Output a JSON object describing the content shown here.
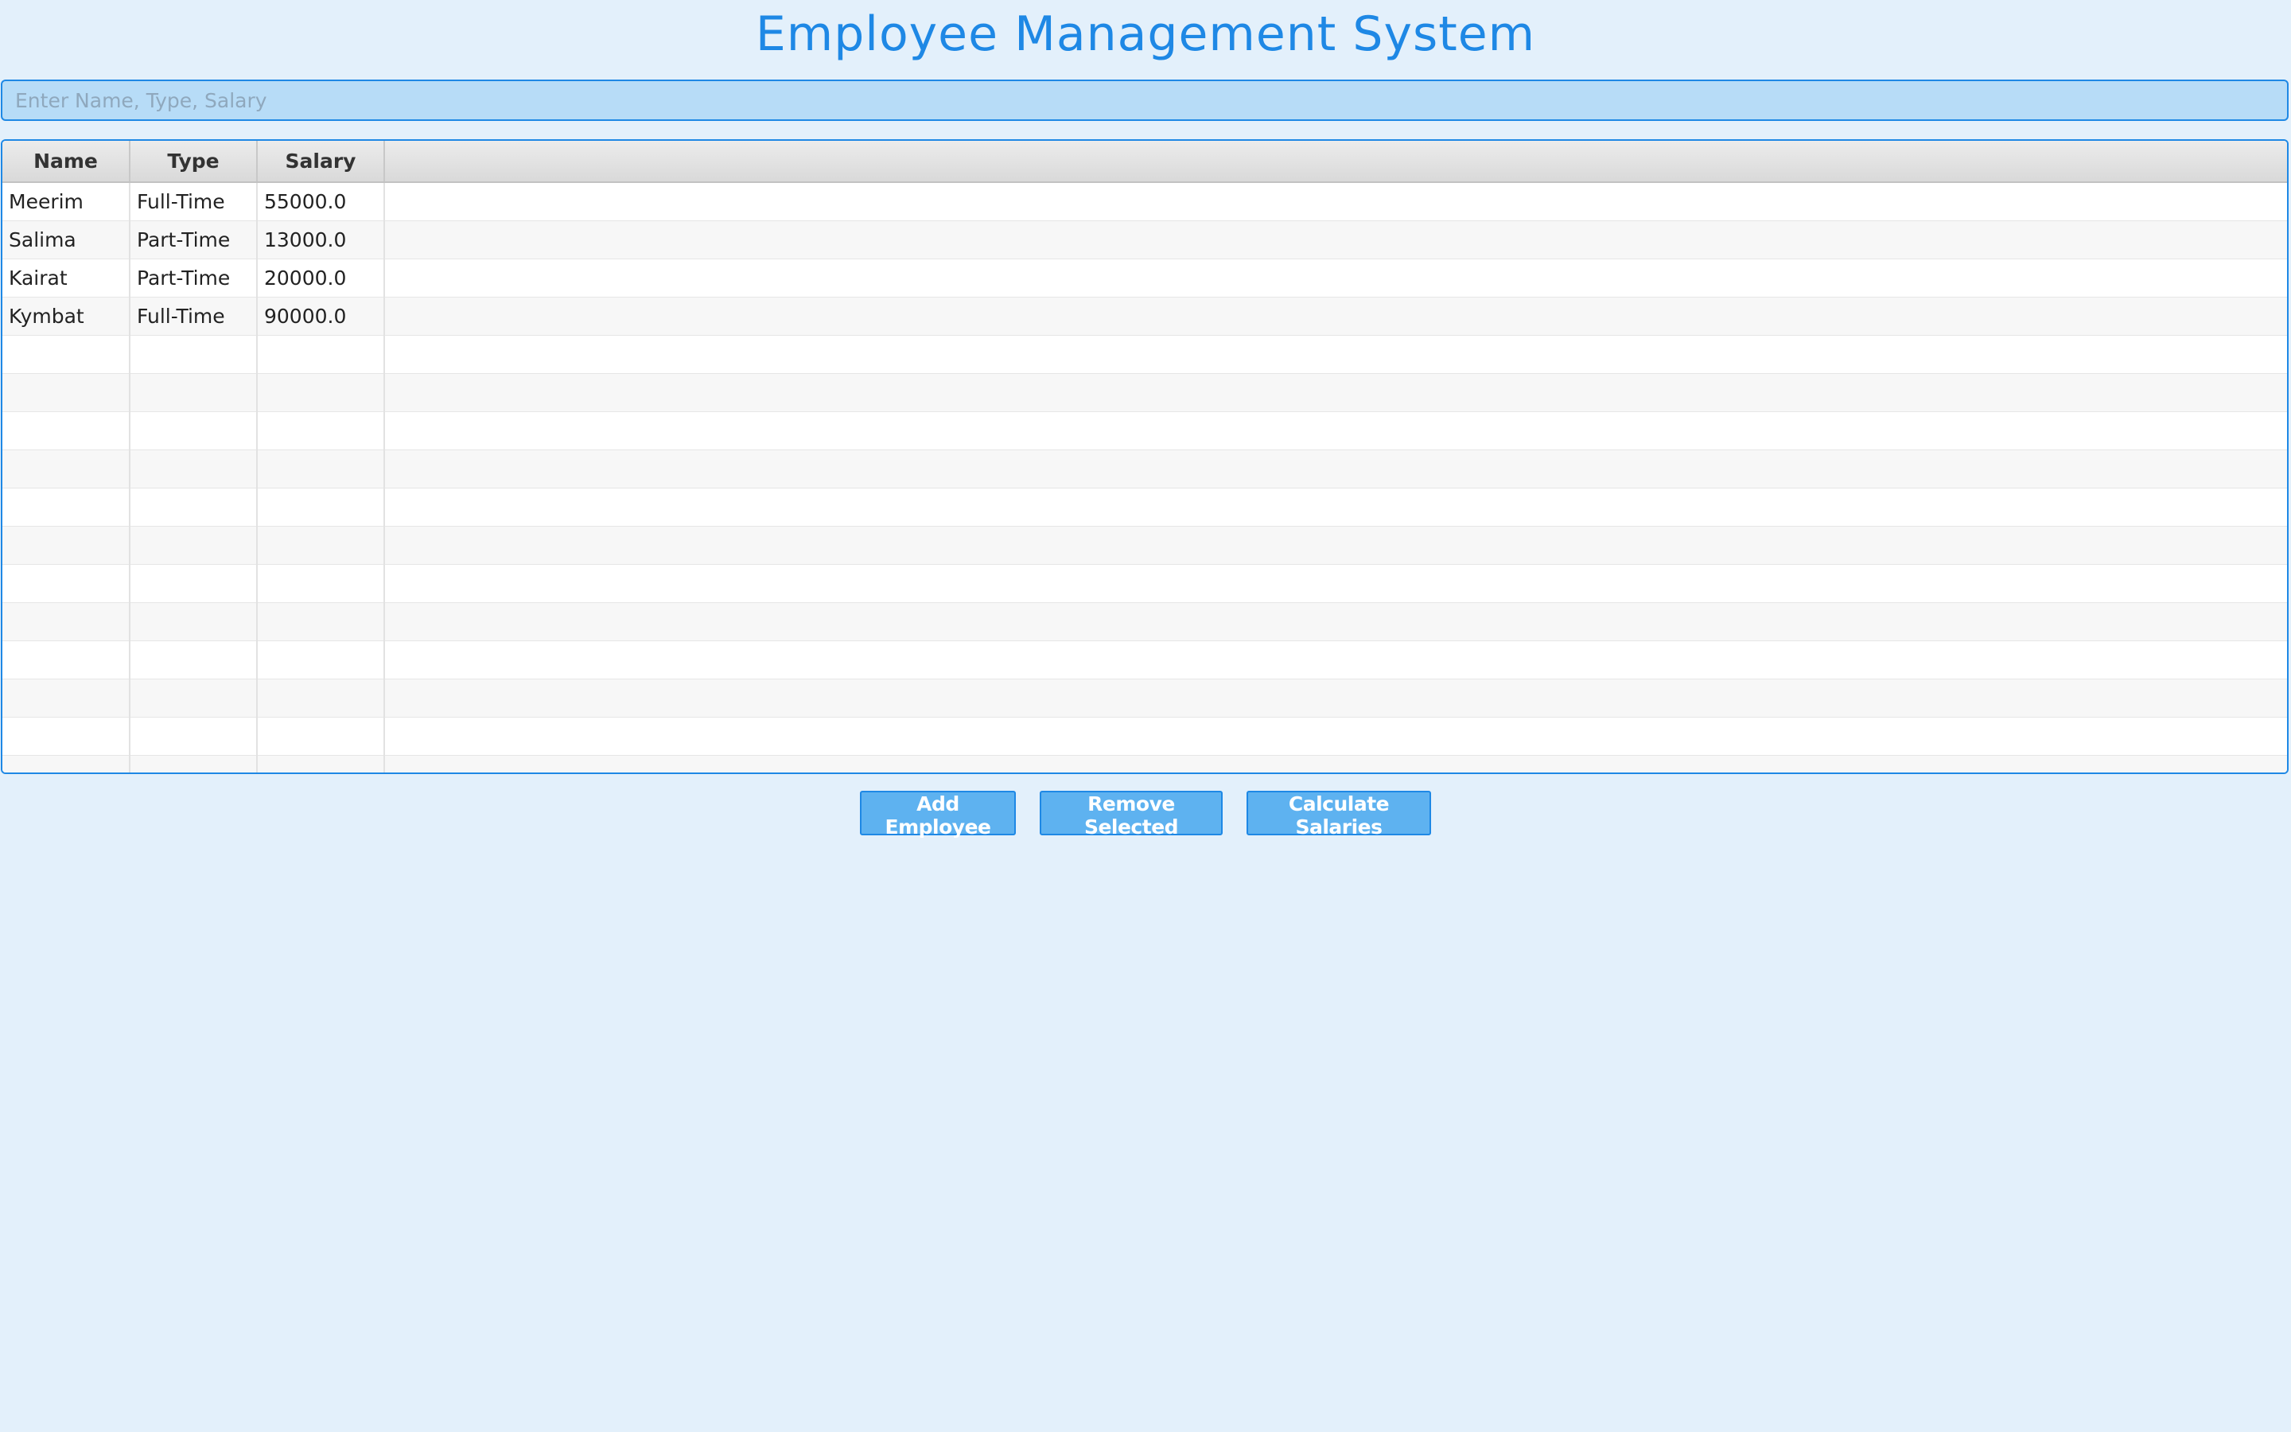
{
  "app": {
    "title": "Employee Management System"
  },
  "search": {
    "placeholder": "Enter Name, Type, Salary",
    "value": ""
  },
  "table": {
    "columns": [
      "Name",
      "Type",
      "Salary",
      ""
    ],
    "rows": [
      [
        "Meerim",
        "Full-Time",
        "55000.0",
        ""
      ],
      [
        "Salima",
        "Part-Time",
        "13000.0",
        ""
      ],
      [
        "Kairat",
        "Part-Time",
        "20000.0",
        ""
      ],
      [
        "Kymbat",
        "Full-Time",
        "90000.0",
        ""
      ],
      [
        "",
        "",
        "",
        ""
      ],
      [
        "",
        "",
        "",
        ""
      ],
      [
        "",
        "",
        "",
        ""
      ],
      [
        "",
        "",
        "",
        ""
      ],
      [
        "",
        "",
        "",
        ""
      ],
      [
        "",
        "",
        "",
        ""
      ],
      [
        "",
        "",
        "",
        ""
      ],
      [
        "",
        "",
        "",
        ""
      ],
      [
        "",
        "",
        "",
        ""
      ],
      [
        "",
        "",
        "",
        ""
      ],
      [
        "",
        "",
        "",
        ""
      ],
      [
        "",
        "",
        "",
        ""
      ]
    ]
  },
  "buttons": {
    "add_label": "Add Employee",
    "remove_label": "Remove Selected",
    "calculate_label": "Calculate Salaries"
  },
  "colors": {
    "accent": "#1e88e5",
    "background": "#e3f0fb",
    "button_fill": "#5eb2f0",
    "search_fill": "#b7dcf7"
  }
}
